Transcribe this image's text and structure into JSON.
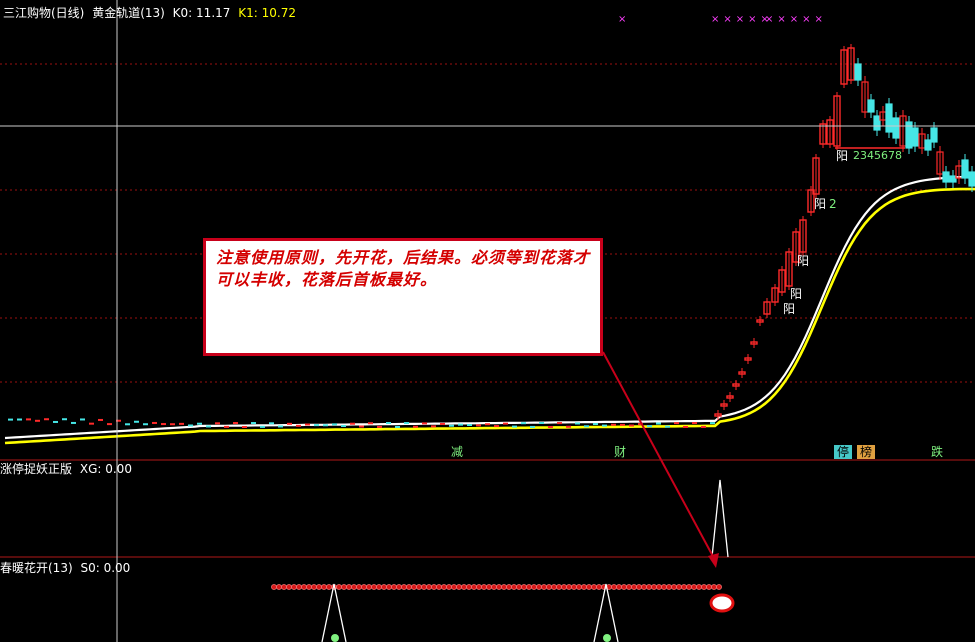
{
  "panel1": {
    "stock": "三江购物(日线)",
    "indicator": "黄金轨道(13)",
    "k0_label": "K0:",
    "k0_value": "11.17",
    "k1_label": "K1:",
    "k1_value": "10.72"
  },
  "panel2": {
    "title": "涨停捉妖正版",
    "label": "XG:",
    "value": "0.00"
  },
  "panel3": {
    "title": "春暖花开(13)",
    "label": "S0:",
    "value": "0.00"
  },
  "annotation": {
    "text": "注意使用原则，先开花，后结果。必须等到花落才可以丰收，花落后首板最好。"
  },
  "event_tags": [
    "减",
    "财",
    "停",
    "榜",
    "跌"
  ],
  "markers": {
    "x1": "×",
    "x2": "×××××",
    "x3": "×××××"
  },
  "candle_labels": {
    "yang1": "阳",
    "yang2": "阳",
    "yang3": "阳",
    "yang4": "阳",
    "yang4_num": "2",
    "yang5": "阳",
    "sequence": "2345678"
  },
  "colors": {
    "up": "#ff2a2a",
    "down": "#46e6e6",
    "line_white": "#ffffff",
    "line_yellow": "#ffff00",
    "grid": "#9a1010",
    "divider": "#b01818",
    "crosshair": "#cccccc",
    "arrow": "#c8001a"
  }
}
